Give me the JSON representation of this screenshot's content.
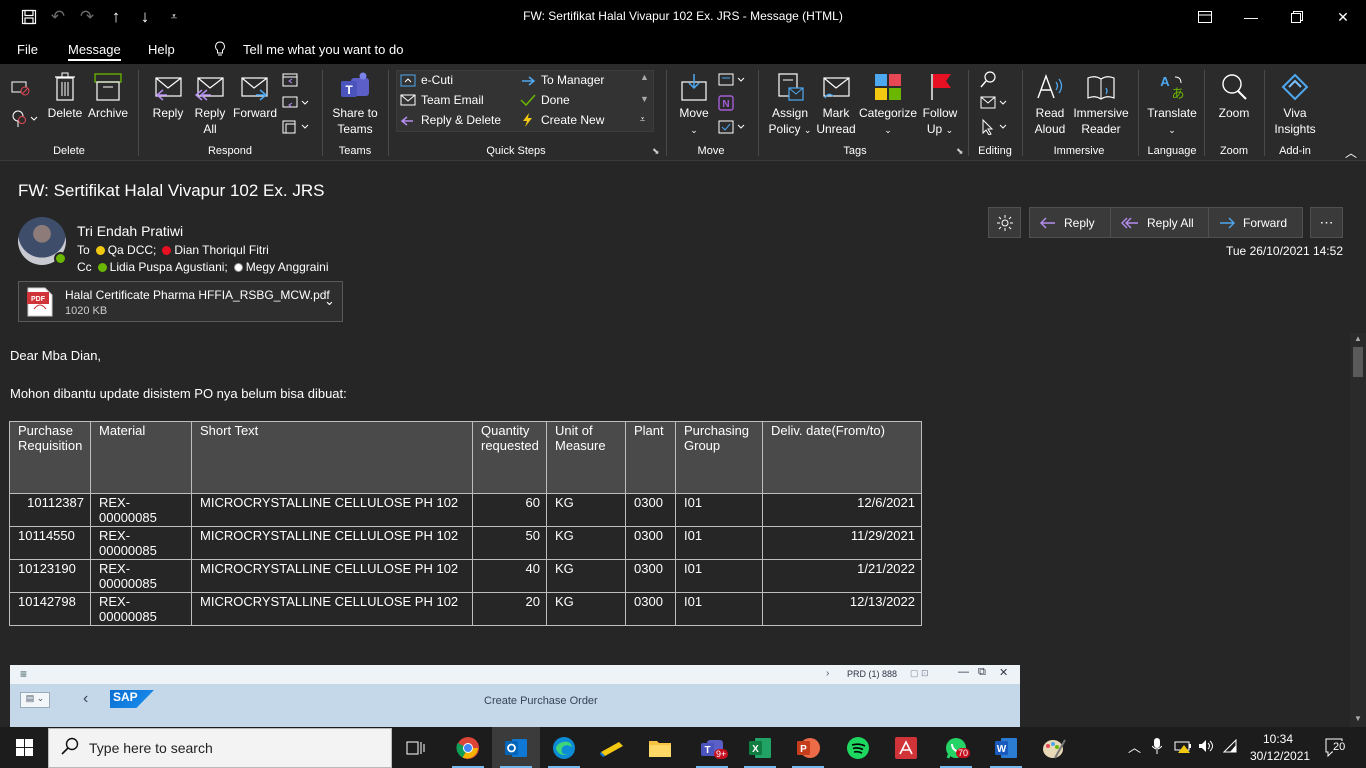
{
  "window": {
    "title": "FW: Sertifikat Halal Vivapur 102 Ex. JRS  -  Message (HTML)"
  },
  "menu": {
    "tabs": [
      "File",
      "Message",
      "Help"
    ],
    "tell_me": "Tell me what you want to do"
  },
  "ribbon": {
    "delete_group": {
      "label": "Delete",
      "delete": "Delete",
      "archive": "Archive"
    },
    "respond_group": {
      "label": "Respond",
      "reply": "Reply",
      "reply_all_1": "Reply",
      "reply_all_2": "All",
      "forward": "Forward"
    },
    "teams_group": {
      "label": "Teams",
      "share_1": "Share to",
      "share_2": "Teams"
    },
    "quick_steps": {
      "label": "Quick Steps",
      "items": [
        "e-Cuti",
        "Team Email",
        "Reply & Delete",
        "To Manager",
        "Done",
        "Create New"
      ]
    },
    "move_group": {
      "label": "Move",
      "move": "Move"
    },
    "tags_group": {
      "label": "Tags",
      "assign_1": "Assign",
      "assign_2": "Policy",
      "mark_1": "Mark",
      "mark_2": "Unread",
      "categorize": "Categorize",
      "follow_1": "Follow",
      "follow_2": "Up"
    },
    "editing_group": {
      "label": "Editing"
    },
    "immersive_group": {
      "label": "Immersive",
      "read_1": "Read",
      "read_2": "Aloud",
      "reader_1": "Immersive",
      "reader_2": "Reader"
    },
    "language_group": {
      "label": "Language",
      "translate": "Translate"
    },
    "zoom_group": {
      "label": "Zoom",
      "zoom": "Zoom"
    },
    "addin_group": {
      "label": "Add-in",
      "viva_1": "Viva",
      "viva_2": "Insights"
    }
  },
  "message": {
    "subject": "FW: Sertifikat Halal Vivapur 102 Ex. JRS",
    "sender": "Tri Endah Pratiwi",
    "to_label": "To",
    "to": [
      "Qa DCC;",
      "Dian Thoriqul Fitri"
    ],
    "cc_label": "Cc",
    "cc": [
      "Lidia Puspa Agustiani;",
      "Megy Anggraini"
    ],
    "date": "Tue 26/10/2021 14:52",
    "attachment": {
      "name": "Halal Certificate Pharma HFFIA_RSBG_MCW.pdf",
      "size": "1020 KB",
      "type": "PDF"
    },
    "actions": {
      "reply": "Reply",
      "reply_all": "Reply All",
      "forward": "Forward"
    },
    "greeting": "Dear Mba Dian,",
    "body": "Mohon dibantu update disistem PO nya belum bisa dibuat:"
  },
  "table": {
    "headers": [
      [
        "Purchase",
        "Requisition"
      ],
      [
        "Material"
      ],
      [
        "Short Text"
      ],
      [
        "Quantity",
        "requested"
      ],
      [
        "Unit of",
        "Measure"
      ],
      [
        "Plant"
      ],
      [
        "Purchasing",
        "Group"
      ],
      [
        "Deliv. date(From/to)"
      ]
    ],
    "rows": [
      {
        "pr": "10112387",
        "mat1": "REX-",
        "mat2": "00000085",
        "text": "MICROCRYSTALLINE CELLULOSE PH 102",
        "qty": "60",
        "uom": "KG",
        "plant": "0300",
        "pg": "I01",
        "date": "12/6/2021"
      },
      {
        "pr": "10114550",
        "mat1": "REX-",
        "mat2": "00000085",
        "text": "MICROCRYSTALLINE CELLULOSE PH 102",
        "qty": "50",
        "uom": "KG",
        "plant": "0300",
        "pg": "I01",
        "date": "11/29/2021"
      },
      {
        "pr": "10123190",
        "mat1": "REX-",
        "mat2": "00000085",
        "text": "MICROCRYSTALLINE CELLULOSE PH 102",
        "qty": "40",
        "uom": "KG",
        "plant": "0300",
        "pg": "I01",
        "date": "1/21/2022"
      },
      {
        "pr": "10142798",
        "mat1": "REX-",
        "mat2": "00000085",
        "text": "MICROCRYSTALLINE CELLULOSE PH 102",
        "qty": "20",
        "uom": "KG",
        "plant": "0300",
        "pg": "I01",
        "date": "12/13/2022"
      }
    ]
  },
  "sap": {
    "logo": "SAP",
    "title": "Create Purchase Order",
    "system": "PRD (1) 888"
  },
  "taskbar": {
    "search_placeholder": "Type here to search",
    "time": "10:34",
    "date": "30/12/2021",
    "notifications": "20",
    "teams_badge": "9+",
    "whatsapp_badge": "70"
  },
  "colors": {
    "ribbon_bg": "#2b2b2b",
    "accent_blue": "#4ea8f0",
    "header_bg": "#4a4a4a"
  }
}
